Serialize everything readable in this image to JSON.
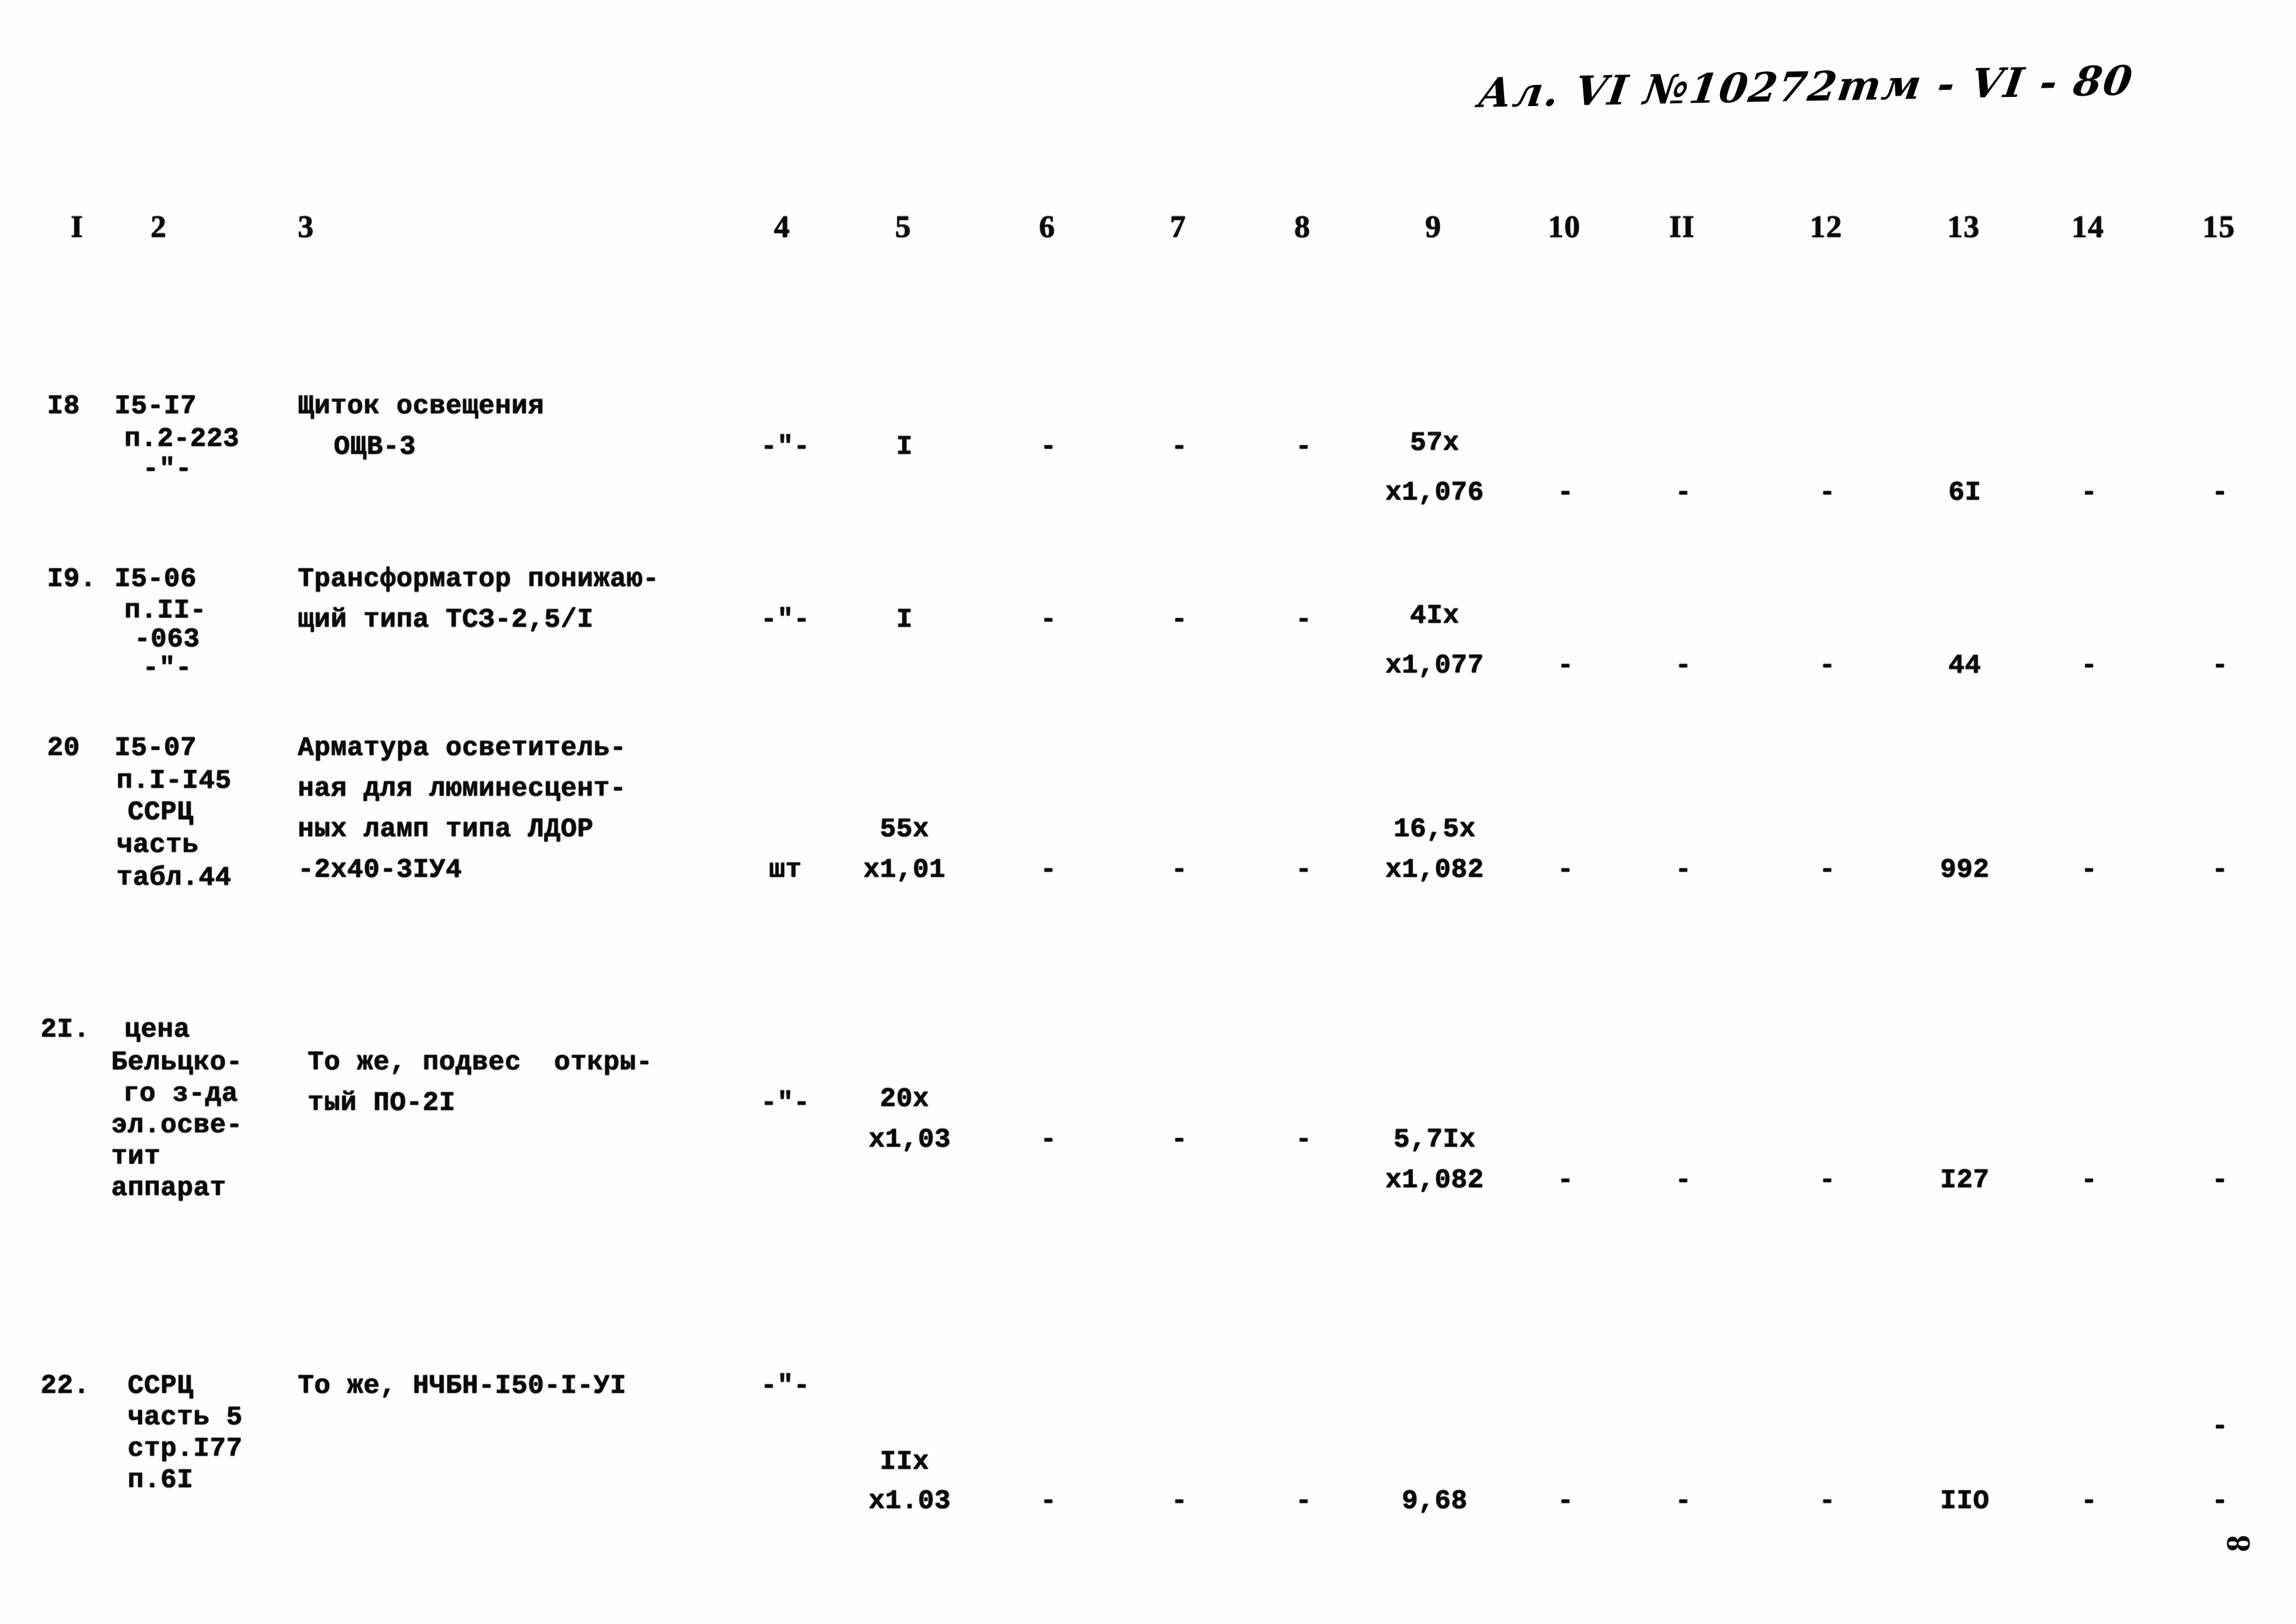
{
  "document": {
    "handwritten_header": "Ал. VI №10272тм - VI - 80",
    "page_number": "8"
  },
  "table": {
    "column_headers": [
      "I",
      "2",
      "3",
      "4",
      "5",
      "6",
      "7",
      "8",
      "9",
      "10",
      "II",
      "12",
      "13",
      "14",
      "15"
    ],
    "rows": [
      {
        "id": "row-18",
        "c1": "I8",
        "c2": [
          "I5-I7",
          "п.2-223",
          "-\"-"
        ],
        "c3": [
          "Щиток освещения",
          "ОЩВ-3"
        ],
        "c4": "-\"-",
        "c5": "I",
        "c6": "-",
        "c7": "-",
        "c8": "-",
        "c9_top": "57х",
        "c9_bot": "х1,076",
        "c10": "-",
        "c11": "-",
        "c12": "-",
        "c13": "6I",
        "c14": "-",
        "c15": "-"
      },
      {
        "id": "row-19",
        "c1": "I9.",
        "c2": [
          "I5-06",
          "п.II-",
          "-063",
          "-\"-"
        ],
        "c3": [
          "Трансформатор понижаю-",
          "щий типа ТСЗ-2,5/I"
        ],
        "c4": "-\"-",
        "c5": "I",
        "c6": "-",
        "c7": "-",
        "c8": "-",
        "c9_top": "4Iх",
        "c9_bot": "х1,077",
        "c10": "-",
        "c11": "-",
        "c12": "-",
        "c13": "44",
        "c14": "-",
        "c15": "-"
      },
      {
        "id": "row-20",
        "c1": "20",
        "c2": [
          "I5-07",
          "п.I-I45",
          "ССРЦ",
          "часть",
          "табл.44"
        ],
        "c3": [
          "Арматура осветитель-",
          "ная для люминесцент-",
          "ных ламп типа ЛДОР",
          "-2х40-3IУ4"
        ],
        "c4": "шт",
        "c5_top": "55х",
        "c5_bot": "х1,01",
        "c6": "-",
        "c7": "-",
        "c8": "-",
        "c9_top": "16,5х",
        "c9_bot": "х1,082",
        "c10": "-",
        "c11": "-",
        "c12": "-",
        "c13": "992",
        "c14": "-",
        "c15": "-"
      },
      {
        "id": "row-21",
        "c1": "2I.",
        "c2": [
          "цена",
          "Бельцко-",
          "го з-да",
          "эл.осве-",
          "тит",
          "аппарат"
        ],
        "c3": [
          "То же, подвес  откры-",
          "тый ПО-2I"
        ],
        "c4": "-\"-",
        "c5_top": "20х",
        "c5_bot": "х1,03",
        "c6": "-",
        "c7": "-",
        "c8": "-",
        "c9_top": "5,7Iх",
        "c9_bot": "х1,082",
        "c10": "-",
        "c11": "-",
        "c12": "-",
        "c13": "I27",
        "c14": "-",
        "c15": "-"
      },
      {
        "id": "row-22",
        "c1": "22.",
        "c2": [
          "ССРЦ",
          "часть 5",
          "стр.I77",
          "п.6I"
        ],
        "c3": [
          "То же, НЧБН-I50-I-УI"
        ],
        "c4": "-\"-",
        "c5_top": "IIх",
        "c5_bot": "х1.03",
        "c6": "-",
        "c7": "-",
        "c8": "-",
        "c9": "9,68",
        "c10": "-",
        "c11": "-",
        "c12": "-",
        "c13": "IIO",
        "c14": "-",
        "c15": "-",
        "c15_upper": "-"
      }
    ]
  }
}
